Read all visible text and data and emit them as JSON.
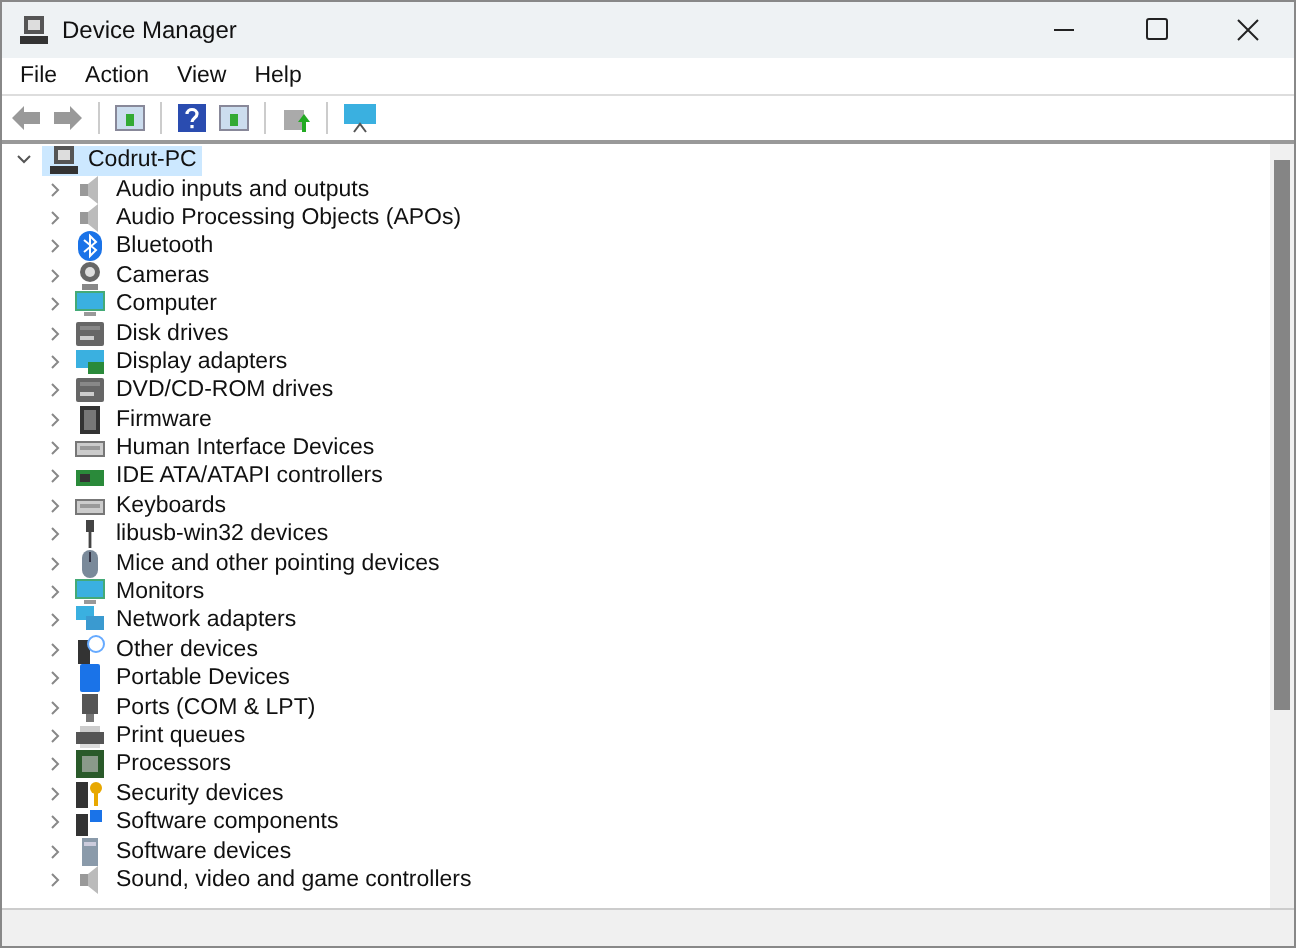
{
  "window": {
    "title": "Device Manager"
  },
  "menu": [
    "File",
    "Action",
    "View",
    "Help"
  ],
  "tree": {
    "label": "Codrut-PC",
    "expanded": true,
    "selected": true,
    "children": [
      {
        "label": "Audio inputs and outputs",
        "expanded": false
      },
      {
        "label": "Audio Processing Objects (APOs)",
        "expanded": false
      },
      {
        "label": "Bluetooth",
        "expanded": false
      },
      {
        "label": "Cameras",
        "expanded": false
      },
      {
        "label": "Computer",
        "expanded": false
      },
      {
        "label": "Disk drives",
        "expanded": false
      },
      {
        "label": "Display adapters",
        "expanded": false
      },
      {
        "label": "DVD/CD-ROM drives",
        "expanded": false
      },
      {
        "label": "Firmware",
        "expanded": false
      },
      {
        "label": "Human Interface Devices",
        "expanded": false
      },
      {
        "label": "IDE ATA/ATAPI controllers",
        "expanded": false
      },
      {
        "label": "Keyboards",
        "expanded": false
      },
      {
        "label": "libusb-win32 devices",
        "expanded": false
      },
      {
        "label": "Mice and other pointing devices",
        "expanded": false
      },
      {
        "label": "Monitors",
        "expanded": false
      },
      {
        "label": "Network adapters",
        "expanded": false
      },
      {
        "label": "Other devices",
        "expanded": false
      },
      {
        "label": "Portable Devices",
        "expanded": false
      },
      {
        "label": "Ports (COM & LPT)",
        "expanded": false
      },
      {
        "label": "Print queues",
        "expanded": false
      },
      {
        "label": "Processors",
        "expanded": false
      },
      {
        "label": "Security devices",
        "expanded": false
      },
      {
        "label": "Software components",
        "expanded": false
      },
      {
        "label": "Software devices",
        "expanded": false
      },
      {
        "label": "Sound, video and game controllers",
        "expanded": false
      }
    ]
  }
}
